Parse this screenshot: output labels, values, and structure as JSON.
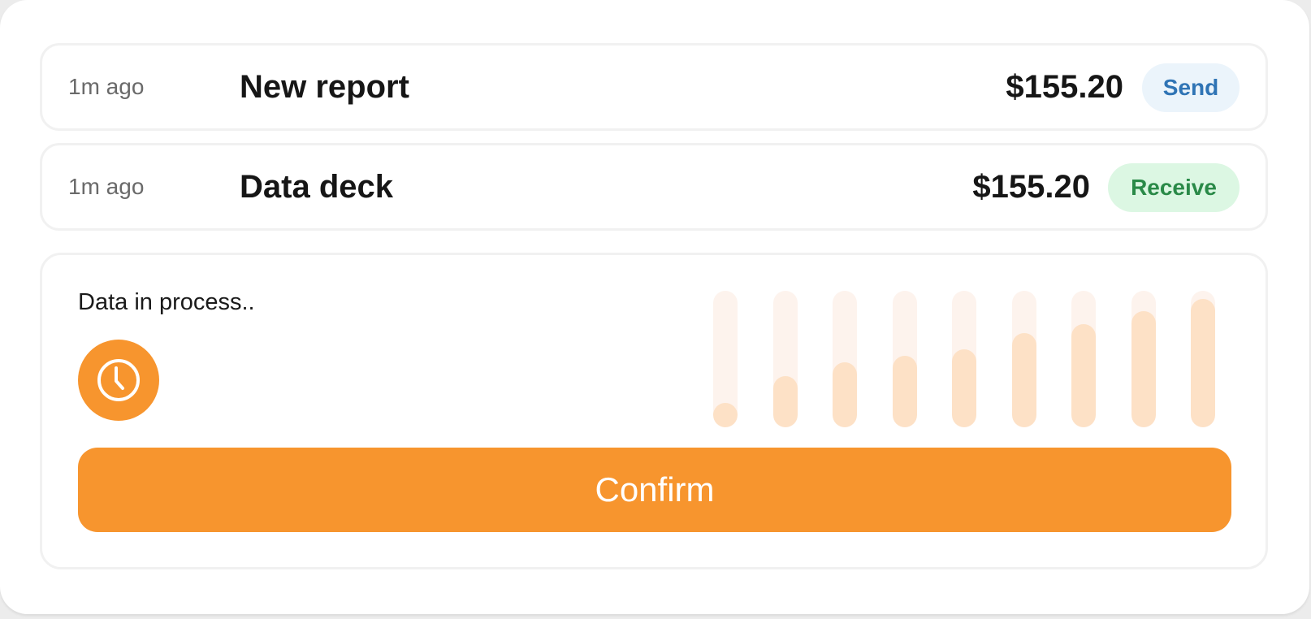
{
  "transactions": [
    {
      "time": "1m ago",
      "title": "New report",
      "amount": "$155.20",
      "action": "Send"
    },
    {
      "time": "1m ago",
      "title": "Data deck",
      "amount": "$155.20",
      "action": "Receive"
    }
  ],
  "process": {
    "status": "Data in process..",
    "icon": "clock-icon",
    "progress_levels": [
      0.0,
      0.24,
      0.36,
      0.42,
      0.48,
      0.62,
      0.7,
      0.82,
      0.93
    ],
    "confirm_label": "Confirm"
  },
  "colors": {
    "accent": "#f7952e",
    "send_bg": "#ebf4fb",
    "send_text": "#2f74b5",
    "receive_bg": "#dcf7e3",
    "receive_text": "#2a8a48",
    "bar_track": "#fdf3ed",
    "bar_fill": "#fde1c6"
  }
}
